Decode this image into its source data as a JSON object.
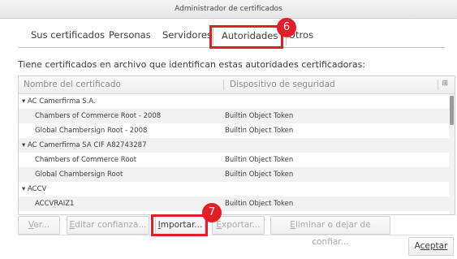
{
  "window": {
    "title": "Administrador de certificados"
  },
  "tabs": [
    {
      "label": "Sus certificados"
    },
    {
      "label": "Personas"
    },
    {
      "label": "Servidores"
    },
    {
      "label": "Autoridades"
    },
    {
      "label": "Otros"
    }
  ],
  "description": "Tiene certificados en archivo que identifican estas autoridades certificadoras:",
  "table": {
    "columns": [
      "Nombre del certificado",
      "Dispositivo de seguridad"
    ],
    "column_picker_icon": "column-picker-icon",
    "rows": [
      {
        "type": "group",
        "name": "▾ AC Camerfirma S.A.",
        "device": ""
      },
      {
        "type": "item",
        "name": "Chambers of Commerce Root - 2008",
        "device": "Builtin Object Token"
      },
      {
        "type": "item",
        "name": "Global Chambersign Root - 2008",
        "device": "Builtin Object Token"
      },
      {
        "type": "group",
        "name": "▾ AC Camerfirma SA CIF A82743287",
        "device": ""
      },
      {
        "type": "item",
        "name": "Chambers of Commerce Root",
        "device": "Builtin Object Token"
      },
      {
        "type": "item",
        "name": "Global Chambersign Root",
        "device": "Builtin Object Token"
      },
      {
        "type": "group",
        "name": "▾ ACCV",
        "device": ""
      },
      {
        "type": "item",
        "name": "ACCVRAIZ1",
        "device": "Builtin Object Token"
      }
    ]
  },
  "buttons": {
    "ver": {
      "first": "V",
      "rest": "er...",
      "enabled": false
    },
    "editar": {
      "first": "E",
      "rest": "ditar confianza...",
      "enabled": false
    },
    "importar": {
      "first": "I",
      "rest": "mportar...",
      "enabled": true
    },
    "exportar": {
      "first": "E",
      "rest": "xportar...",
      "enabled": false
    },
    "eliminar": {
      "first": "E",
      "rest": "liminar o dejar de confiar...",
      "enabled": false
    },
    "aceptar": {
      "first": "A",
      "rest": "ceptar",
      "enabled": true
    }
  },
  "callouts": [
    {
      "number": "6",
      "target": "Autoridades tab"
    },
    {
      "number": "7",
      "target": "Importar button"
    }
  ],
  "colors": {
    "callout": "#e21e26",
    "selected_row": "#f1f1f1"
  }
}
